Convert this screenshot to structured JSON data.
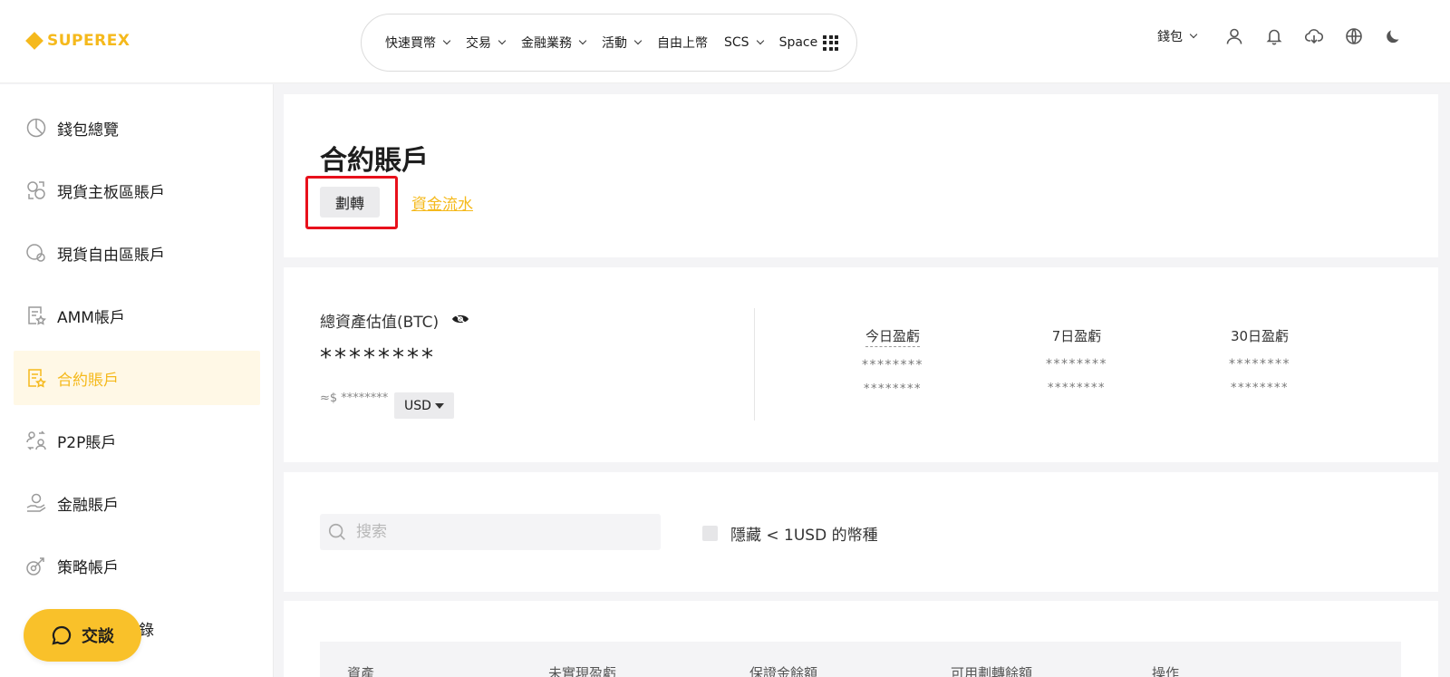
{
  "header": {
    "logo_text": "SUPEREX",
    "nav": [
      {
        "label": "快速買幣",
        "has_dropdown": true
      },
      {
        "label": "交易",
        "has_dropdown": true
      },
      {
        "label": "金融業務",
        "has_dropdown": true
      },
      {
        "label": "活動",
        "has_dropdown": true
      },
      {
        "label": "自由上幣",
        "has_dropdown": false
      },
      {
        "label": "SCS",
        "has_dropdown": true
      },
      {
        "label": "Space",
        "has_dropdown": false
      }
    ],
    "wallet_label": "錢包",
    "icons": [
      "user-icon",
      "bell-icon",
      "download-icon",
      "globe-icon",
      "moon-icon"
    ]
  },
  "sidebar": {
    "items": [
      {
        "label": "錢包總覽",
        "icon": "pie-chart-icon",
        "active": false
      },
      {
        "label": "現貨主板區賬戶",
        "icon": "exchange-circle-icon",
        "active": false
      },
      {
        "label": "現貨自由區賬戶",
        "icon": "coins-icon",
        "active": false
      },
      {
        "label": "AMM帳戶",
        "icon": "doc-star-icon",
        "active": false
      },
      {
        "label": "合約賬戶",
        "icon": "doc-star-icon",
        "active": true
      },
      {
        "label": "P2P賬戶",
        "icon": "p2p-users-icon",
        "active": false
      },
      {
        "label": "金融賬戶",
        "icon": "hand-coin-icon",
        "active": false
      },
      {
        "label": "策略帳戶",
        "icon": "strategy-icon",
        "active": false
      },
      {
        "label": "錄",
        "icon": "",
        "active": false
      }
    ],
    "chat_label": "交談"
  },
  "main": {
    "title": "合約賬戶",
    "transfer_label": "劃轉",
    "flow_label": "資金流水",
    "assets": {
      "label": "總資產估值(BTC)",
      "value": "********",
      "approx": "≈$ ********",
      "currency": "USD"
    },
    "pnl": [
      {
        "label": "今日盈虧",
        "v1": "********",
        "v2": "********"
      },
      {
        "label": "7日盈虧",
        "v1": "********",
        "v2": "********"
      },
      {
        "label": "30日盈虧",
        "v1": "********",
        "v2": "********"
      }
    ],
    "search_placeholder": "搜索",
    "hide_small_label": "隱藏 < 1USD 的幣種",
    "table_headers": [
      "資產",
      "未實現盈虧",
      "保證金餘額",
      "可用劃轉餘額",
      "操作"
    ]
  },
  "colors": {
    "accent": "#f5b91c",
    "highlight_box": "#e8101b",
    "chat_button": "#f9c12a"
  }
}
